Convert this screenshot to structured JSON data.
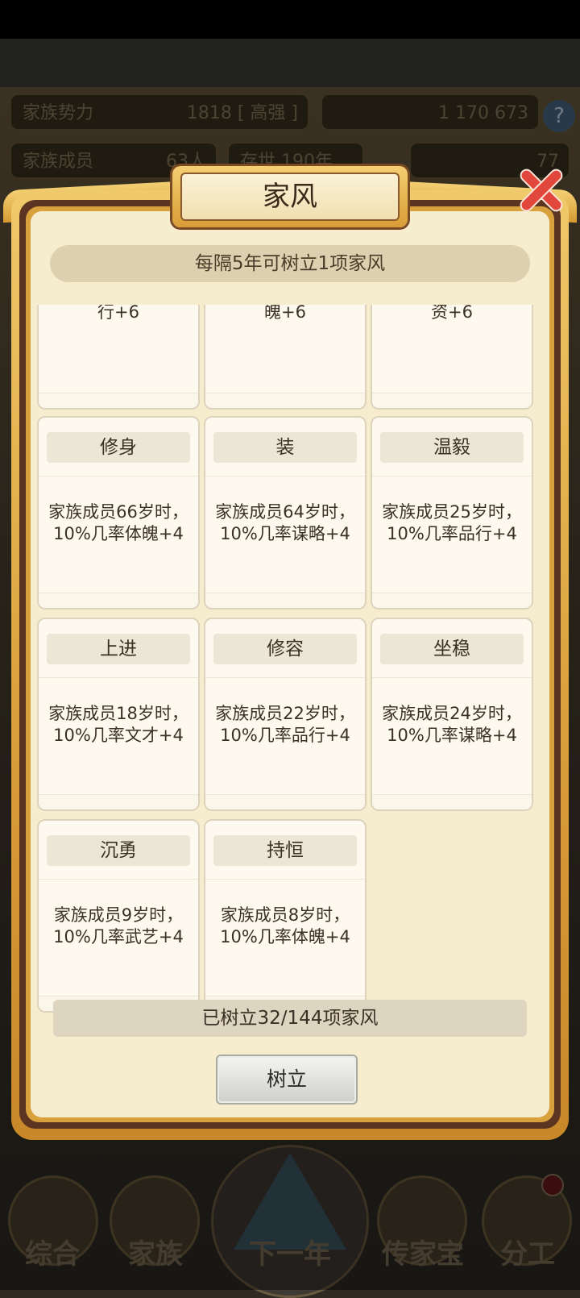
{
  "hud": {
    "power_label": "家族势力",
    "power_value": "1818",
    "power_rank": "[ 高强 ]",
    "currency": "1 170 673",
    "members_label": "家族成员",
    "members_value": "63人",
    "survive_label": "存世 190年",
    "gold_value": "77",
    "help_icon": "?"
  },
  "nav": {
    "items": [
      {
        "label": "综合"
      },
      {
        "label": "家族"
      },
      {
        "label": "下一年"
      },
      {
        "label": "传家宝"
      },
      {
        "label": "分工"
      }
    ]
  },
  "dialog": {
    "title": "家风",
    "hint": "每隔5年可树立1项家风",
    "partial_row": [
      "行+6",
      "魄+6",
      "资+6"
    ],
    "cards": [
      {
        "name": "修身",
        "desc": "家族成员66岁时，10%几率体魄+4"
      },
      {
        "name": "装",
        "desc": "家族成员64岁时，10%几率谋略+4"
      },
      {
        "name": "温毅",
        "desc": "家族成员25岁时，10%几率品行+4"
      },
      {
        "name": "上进",
        "desc": "家族成员18岁时，10%几率文才+4"
      },
      {
        "name": "修容",
        "desc": "家族成员22岁时，10%几率品行+4"
      },
      {
        "name": "坐稳",
        "desc": "家族成员24岁时，10%几率谋略+4"
      },
      {
        "name": "沉勇",
        "desc": "家族成员9岁时，10%几率武艺+4"
      },
      {
        "name": "持恒",
        "desc": "家族成员8岁时，10%几率体魄+4"
      }
    ],
    "counter": "已树立32/144项家风",
    "establish_button": "树立"
  }
}
